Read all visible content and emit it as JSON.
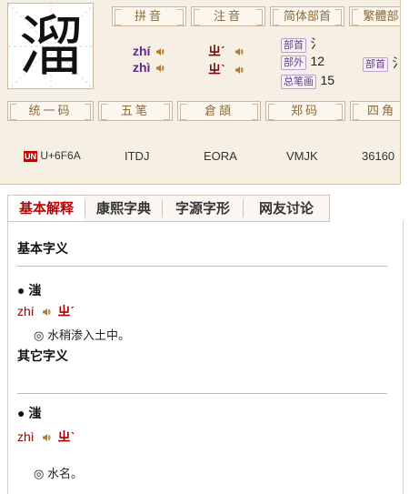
{
  "char": {
    "glyph": "溜",
    "headers": {
      "pinyin": "拼音",
      "zhuyin": "注音",
      "simp_radical": "简体部首",
      "trad_radical": "繁體部",
      "unicode": "统一码",
      "wubi": "五笔",
      "cangjie": "倉頡",
      "zhengma": "郑码",
      "sijiao": "四角"
    },
    "pinyin": [
      "zhí",
      "zhì"
    ],
    "zhuyin": [
      "ㄓˊ",
      "ㄓˋ"
    ],
    "bushou": {
      "label": "部首",
      "value": "氵"
    },
    "buwai": {
      "label": "部外",
      "value": "12"
    },
    "zongbihua": {
      "label": "总笔画",
      "value": "15"
    },
    "trad_bushou": {
      "label": "部首",
      "value": "氵"
    },
    "unicode_badge": "UN",
    "unicode": "U+6F6A",
    "wubi": "ITDJ",
    "cangjie": "EORA",
    "zhengma": "VMJK",
    "sijiao": "36160"
  },
  "tabs": [
    "基本解释",
    "康熙字典",
    "字源字形",
    "网友讨论"
  ],
  "active_tab": 0,
  "content": {
    "basic_heading": "基本字义",
    "other_heading": "其它字义",
    "entries": [
      {
        "char": "● 滍",
        "pinyin": "zhí",
        "zhuyin": "ㄓˊ",
        "def": "◎ 水稍渗入土中。"
      },
      {
        "char": "● 滍",
        "pinyin": "zhì",
        "zhuyin": "ㄓˋ",
        "def": "◎ 水名。"
      }
    ]
  },
  "colors": {
    "accent": "#b00000",
    "card_bg": "#f6efe4",
    "pinyin": "#5a2a8a"
  }
}
